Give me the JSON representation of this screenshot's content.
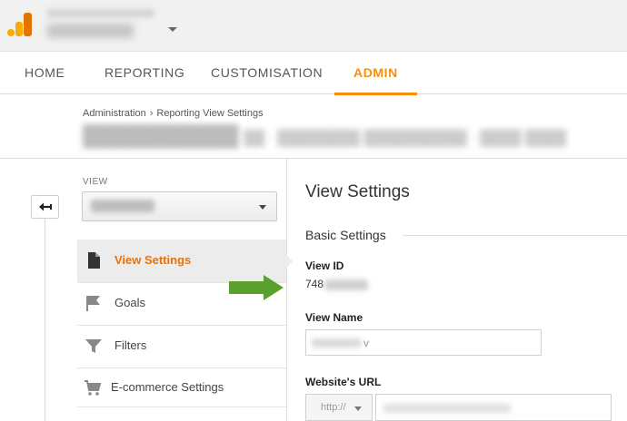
{
  "nav": {
    "items": [
      {
        "label": "HOME"
      },
      {
        "label": "REPORTING"
      },
      {
        "label": "CUSTOMISATION"
      },
      {
        "label": "ADMIN"
      }
    ]
  },
  "breadcrumb": {
    "root": "Administration",
    "separator": "›",
    "current": "Reporting View Settings"
  },
  "left": {
    "view_label": "VIEW",
    "menu": [
      {
        "label": "View Settings",
        "icon": "document-icon"
      },
      {
        "label": "Goals",
        "icon": "flag-icon"
      },
      {
        "label": "Filters",
        "icon": "filter-icon"
      },
      {
        "label": "E-commerce Settings",
        "icon": "cart-icon"
      }
    ]
  },
  "panel": {
    "title": "View Settings",
    "section": "Basic Settings",
    "view_id_label": "View ID",
    "view_id_visible": "748",
    "view_name_label": "View Name",
    "view_name_tail": "v",
    "website_url_label": "Website's URL",
    "protocol": "http://"
  },
  "colors": {
    "accent": "#f4900c",
    "active_item": "#e8710a",
    "arrow": "#5aa02c"
  }
}
